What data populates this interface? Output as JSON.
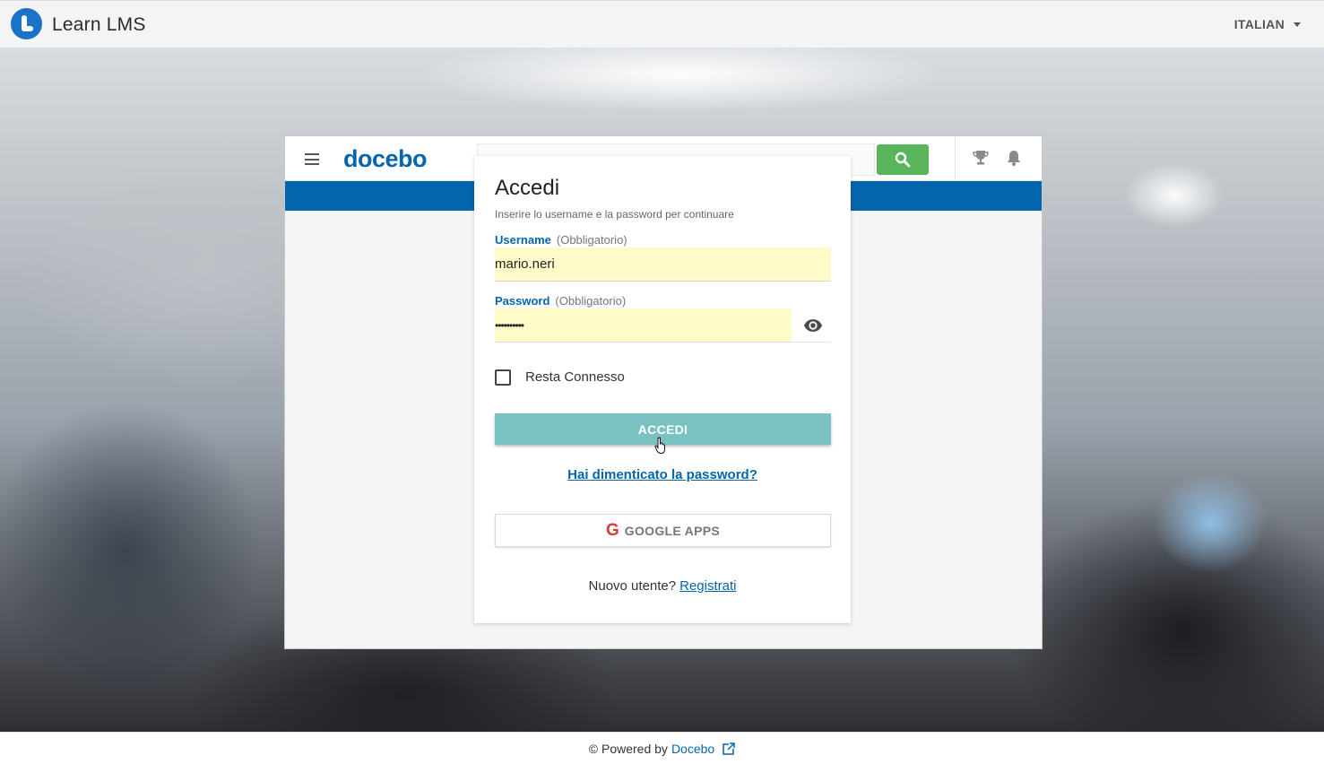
{
  "topbar": {
    "brand_name": "Learn LMS",
    "language": "ITALIAN"
  },
  "frame": {
    "logo_text": "docebo",
    "icons": [
      "hamburger-icon",
      "search-icon",
      "trophy-icon",
      "bell-icon"
    ]
  },
  "login": {
    "title": "Accedi",
    "subtitle": "Inserire lo username e la password per continuare",
    "username_label": "Username",
    "username_required": "(Obbligatorio)",
    "username_value": "mario.neri",
    "password_label": "Password",
    "password_required": "(Obbligatorio)",
    "password_value": "••••••••••",
    "remember_label": "Resta Connesso",
    "remember_checked": false,
    "submit_label": "ACCEDI",
    "forgot_label": "Hai dimenticato la password?",
    "google_label": "GOOGLE APPS",
    "google_letter": "G",
    "new_user_text": "Nuovo utente?",
    "register_label": "Registrati"
  },
  "footer": {
    "prefix": "© Powered by",
    "link": "Docebo"
  },
  "colors": {
    "brand_blue": "#0465ac",
    "accedi_button": "#7ac2c1",
    "autofill_yellow": "#fefbc9",
    "search_green": "#58b55c",
    "google_red": "#d23f31"
  }
}
